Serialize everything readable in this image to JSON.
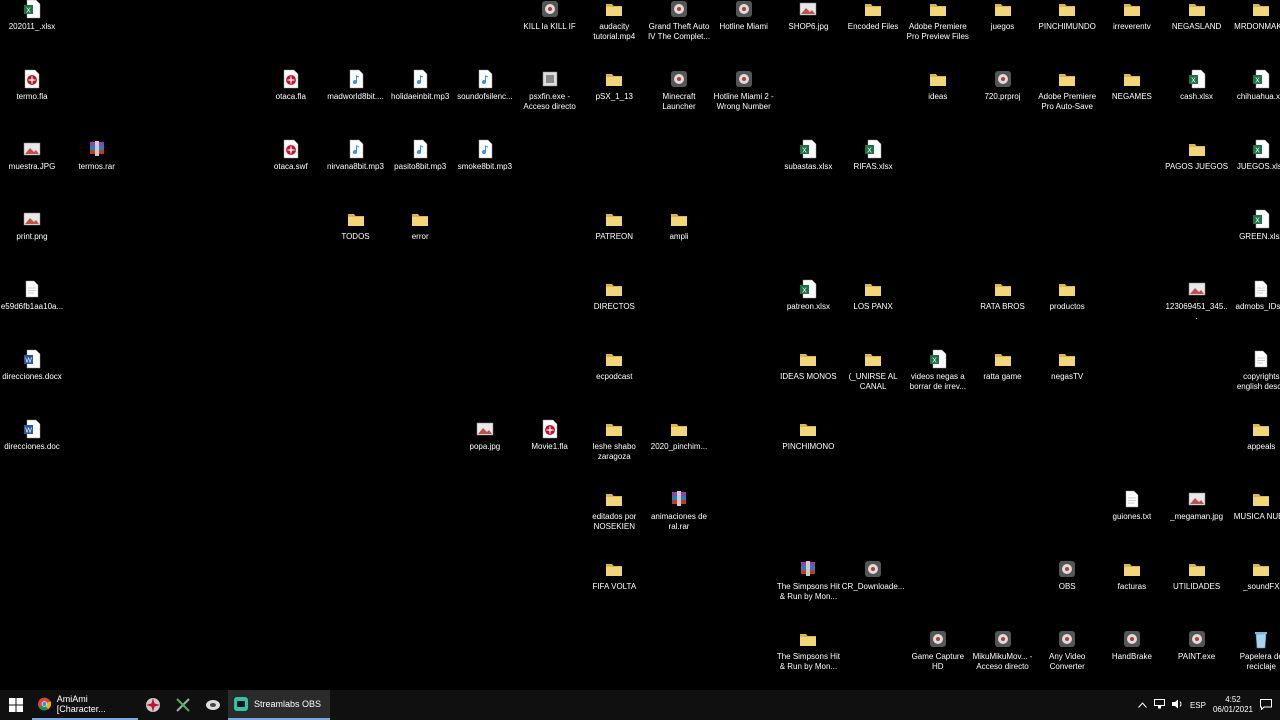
{
  "desktop": {
    "icons": [
      {
        "name": "202011_.xlsx",
        "type": "xlsx",
        "col": 0,
        "row": 0
      },
      {
        "name": "termo.fla",
        "type": "fla",
        "col": 0,
        "row": 1
      },
      {
        "name": "muestra.JPG",
        "type": "img",
        "col": 0,
        "row": 2
      },
      {
        "name": "print.png",
        "type": "img",
        "col": 0,
        "row": 3
      },
      {
        "name": "e59d6fb1aa10a...",
        "type": "file",
        "col": 0,
        "row": 4
      },
      {
        "name": "direcciones.docx",
        "type": "docx",
        "col": 0,
        "row": 5
      },
      {
        "name": "direcciones.doc",
        "type": "docx",
        "col": 0,
        "row": 6
      },
      {
        "name": "termos.rar",
        "type": "rar",
        "col": 1,
        "row": 2
      },
      {
        "name": "otaca.fla",
        "type": "fla",
        "col": 4,
        "row": 1
      },
      {
        "name": "otaca.swf",
        "type": "fla",
        "col": 4,
        "row": 2
      },
      {
        "name": "madworld8bit....",
        "type": "mp3",
        "col": 5,
        "row": 1
      },
      {
        "name": "nirvana8bit.mp3",
        "type": "mp3",
        "col": 5,
        "row": 2
      },
      {
        "name": "TODOS",
        "type": "folder",
        "col": 5,
        "row": 3
      },
      {
        "name": "holidaeinbit.mp3",
        "type": "mp3",
        "col": 6,
        "row": 1
      },
      {
        "name": "pasito8bit.mp3",
        "type": "mp3",
        "col": 6,
        "row": 2
      },
      {
        "name": "error",
        "type": "folder",
        "col": 6,
        "row": 3
      },
      {
        "name": "soundofsilenc...",
        "type": "mp3",
        "col": 7,
        "row": 1
      },
      {
        "name": "smoke8bit.mp3",
        "type": "mp3",
        "col": 7,
        "row": 2
      },
      {
        "name": "popa.jpg",
        "type": "img",
        "col": 7,
        "row": 6
      },
      {
        "name": "KILL la KILL IF",
        "type": "app",
        "col": 8,
        "row": 0
      },
      {
        "name": "psxfin.exe - Acceso directo",
        "type": "exe",
        "col": 8,
        "row": 1
      },
      {
        "name": "Movie1.fla",
        "type": "fla",
        "col": 8,
        "row": 6
      },
      {
        "name": "audacity tutorial.mp4",
        "type": "folder",
        "col": 9,
        "row": 0
      },
      {
        "name": "pSX_1_13",
        "type": "folder",
        "col": 9,
        "row": 1
      },
      {
        "name": "PATREON",
        "type": "folder",
        "col": 9,
        "row": 3
      },
      {
        "name": "DIRECTOS",
        "type": "folder",
        "col": 9,
        "row": 4
      },
      {
        "name": "ecpodcast",
        "type": "folder",
        "col": 9,
        "row": 5
      },
      {
        "name": "leshe shabo zaragoza",
        "type": "folder",
        "col": 9,
        "row": 6
      },
      {
        "name": "editados por NOSEKIEN",
        "type": "folder",
        "col": 9,
        "row": 7
      },
      {
        "name": "FIFA VOLTA",
        "type": "folder",
        "col": 9,
        "row": 8
      },
      {
        "name": "Grand Theft Auto IV The Complet...",
        "type": "app",
        "col": 10,
        "row": 0
      },
      {
        "name": "Minecraft Launcher",
        "type": "app",
        "col": 10,
        "row": 1
      },
      {
        "name": "ampli",
        "type": "folder",
        "col": 10,
        "row": 3
      },
      {
        "name": "2020_pinchim...",
        "type": "folder",
        "col": 10,
        "row": 6
      },
      {
        "name": "animaciones de ral.rar",
        "type": "rar",
        "col": 10,
        "row": 7
      },
      {
        "name": "Hotline Miami",
        "type": "app",
        "col": 11,
        "row": 0
      },
      {
        "name": "Hotline Miami 2 - Wrong Number",
        "type": "app",
        "col": 11,
        "row": 1
      },
      {
        "name": "SHOP6.jpg",
        "type": "img",
        "col": 12,
        "row": 0
      },
      {
        "name": "subastas.xlsx",
        "type": "xlsx",
        "col": 12,
        "row": 2
      },
      {
        "name": "patreon.xlsx",
        "type": "xlsx",
        "col": 12,
        "row": 4
      },
      {
        "name": "IDEAS MONOS",
        "type": "folder",
        "col": 12,
        "row": 5
      },
      {
        "name": "PINCHIMONO",
        "type": "folder",
        "col": 12,
        "row": 6
      },
      {
        "name": "The Simpsons Hit & Run by Mon...",
        "type": "rar",
        "col": 12,
        "row": 8
      },
      {
        "name": "The Simpsons Hit & Run by Mon...",
        "type": "folder",
        "col": 12,
        "row": 9
      },
      {
        "name": "Encoded Files",
        "type": "folder",
        "col": 13,
        "row": 0
      },
      {
        "name": "RIFAS.xlsx",
        "type": "xlsx",
        "col": 13,
        "row": 2
      },
      {
        "name": "LOS PANX",
        "type": "folder",
        "col": 13,
        "row": 4
      },
      {
        "name": "(_UNIRSE AL CANAL",
        "type": "folder",
        "col": 13,
        "row": 5
      },
      {
        "name": "CR_Downloade...",
        "type": "app",
        "col": 13,
        "row": 8
      },
      {
        "name": "Adobe Premiere Pro Preview Files",
        "type": "folder",
        "col": 14,
        "row": 0
      },
      {
        "name": "ideas",
        "type": "folder",
        "col": 14,
        "row": 1
      },
      {
        "name": "videos negas a borrar de irrev...",
        "type": "xlsx",
        "col": 14,
        "row": 5
      },
      {
        "name": "Game Capture HD",
        "type": "app",
        "col": 14,
        "row": 9
      },
      {
        "name": "juegos",
        "type": "folder",
        "col": 15,
        "row": 0
      },
      {
        "name": "720.prproj",
        "type": "app",
        "col": 15,
        "row": 1
      },
      {
        "name": "RATA BROS",
        "type": "folder",
        "col": 15,
        "row": 4
      },
      {
        "name": "ratta game",
        "type": "folder",
        "col": 15,
        "row": 5
      },
      {
        "name": "MikuMikuMov... - Acceso directo",
        "type": "app",
        "col": 15,
        "row": 9
      },
      {
        "name": "PINCHIMUNDO",
        "type": "folder",
        "col": 16,
        "row": 0
      },
      {
        "name": "Adobe Premiere Pro Auto-Save",
        "type": "folder",
        "col": 16,
        "row": 1
      },
      {
        "name": "productos",
        "type": "folder",
        "col": 16,
        "row": 4
      },
      {
        "name": "negasTV",
        "type": "folder",
        "col": 16,
        "row": 5
      },
      {
        "name": "OBS",
        "type": "app",
        "col": 16,
        "row": 8
      },
      {
        "name": "Any Video Converter",
        "type": "app",
        "col": 16,
        "row": 9
      },
      {
        "name": "irreverentv",
        "type": "folder",
        "col": 17,
        "row": 0
      },
      {
        "name": "NEGAMES",
        "type": "folder",
        "col": 17,
        "row": 1
      },
      {
        "name": "guiones.txt",
        "type": "file",
        "col": 17,
        "row": 7
      },
      {
        "name": "facturas",
        "type": "folder",
        "col": 17,
        "row": 8
      },
      {
        "name": "HandBrake",
        "type": "app",
        "col": 17,
        "row": 9
      },
      {
        "name": "NEGASLAND",
        "type": "folder",
        "col": 18,
        "row": 0
      },
      {
        "name": "cash.xlsx",
        "type": "xlsx",
        "col": 18,
        "row": 1
      },
      {
        "name": "PAGOS JUEGOS",
        "type": "folder",
        "col": 18,
        "row": 2
      },
      {
        "name": "123069451_345...",
        "type": "img",
        "col": 18,
        "row": 4
      },
      {
        "name": "_megaman.jpg",
        "type": "img",
        "col": 18,
        "row": 7
      },
      {
        "name": "UTILIDADES",
        "type": "folder",
        "col": 18,
        "row": 8
      },
      {
        "name": "PAINT.exe",
        "type": "app",
        "col": 18,
        "row": 9
      },
      {
        "name": "MRDONMAKIL",
        "type": "folder",
        "col": 19,
        "row": 0
      },
      {
        "name": "chihuahua.xls",
        "type": "xlsx",
        "col": 19,
        "row": 1
      },
      {
        "name": "JUEGOS.xlsx",
        "type": "xlsx",
        "col": 19,
        "row": 2
      },
      {
        "name": "GREEN.xlsx",
        "type": "xlsx",
        "col": 19,
        "row": 3
      },
      {
        "name": "admobs_IDs.b",
        "type": "file",
        "col": 19,
        "row": 4
      },
      {
        "name": "copyrights english descr.",
        "type": "file",
        "col": 19,
        "row": 5
      },
      {
        "name": "appeals",
        "type": "folder",
        "col": 19,
        "row": 6
      },
      {
        "name": "MUSICA NUEV",
        "type": "folder",
        "col": 19,
        "row": 7
      },
      {
        "name": "_soundFX",
        "type": "folder",
        "col": 19,
        "row": 8
      },
      {
        "name": "Papelera de reciclaje",
        "type": "bin",
        "col": 19,
        "row": 9
      }
    ]
  },
  "taskbar": {
    "chrome_label": "AmiAmi [Character...",
    "obs_label": "Streamlabs OBS",
    "language": "ESP",
    "time": "4:52",
    "date": "06/01/2021"
  },
  "colors": {
    "folder": "#f2d77a",
    "folder_dark": "#d9b64e",
    "excel": "#1e7145",
    "word": "#2b579a",
    "mp3": "#3a8ee6",
    "fla": "#c8102e",
    "taskbar_bg": "#101010",
    "accent": "#7aa8e0"
  }
}
